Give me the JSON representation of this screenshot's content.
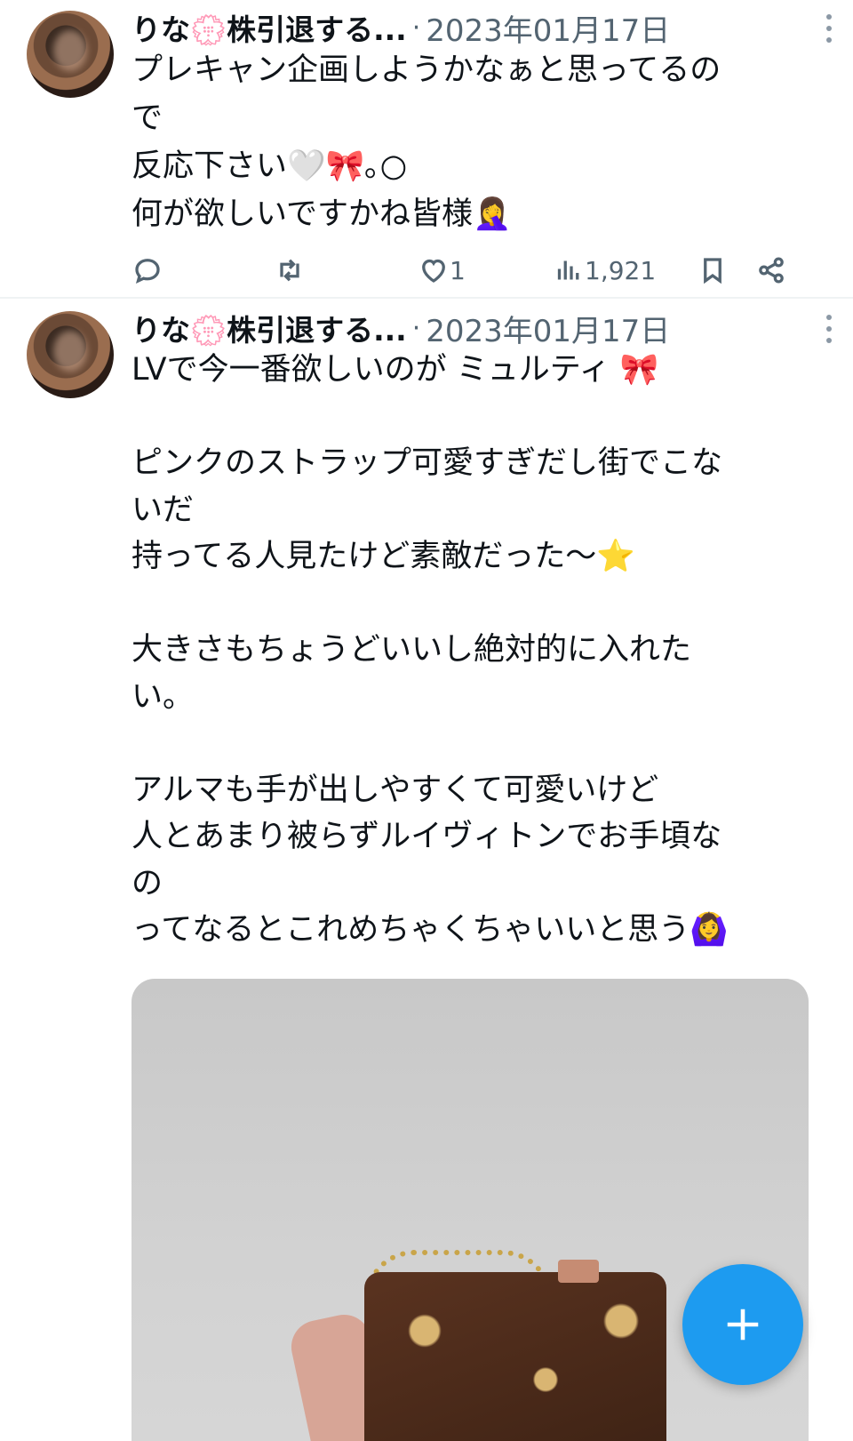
{
  "tweets": [
    {
      "display_name": "りな💮株引退する...",
      "separator": "·",
      "date": "2023年01月17日",
      "text": "プレキャン企画しようかなぁと思ってるの\nで\n反応下さい🤍🎀｡○\n何が欲しいですかね皆様🤦‍♀️",
      "stats": {
        "replies": "",
        "retweets": "",
        "likes": "1",
        "views": "1,921"
      }
    },
    {
      "display_name": "りな💮株引退する...",
      "separator": "·",
      "date": "2023年01月17日",
      "text": "LVで今一番欲しいのが ミュルティ 🎀\n\nピンクのストラップ可愛すぎだし街でこな\nいだ\n持ってる人見たけど素敵だった〜⭐\n\n大きさもちょうどいいし絶対的に入れた\nい。\n\nアルマも手が出しやすくて可愛いけど\n人とあまり被らずルイヴィトンでお手頃な\nの\nってなるとこれめちゃくちゃいいと思う🙆‍♀️"
    }
  ],
  "icons": {
    "reply": "reply-icon",
    "retweet": "retweet-icon",
    "like": "heart-icon",
    "views": "views-icon",
    "bookmark": "bookmark-icon",
    "share": "share-icon",
    "compose": "plus-icon"
  },
  "colors": {
    "accent": "#1d9bf0",
    "secondary_text": "#536471"
  }
}
